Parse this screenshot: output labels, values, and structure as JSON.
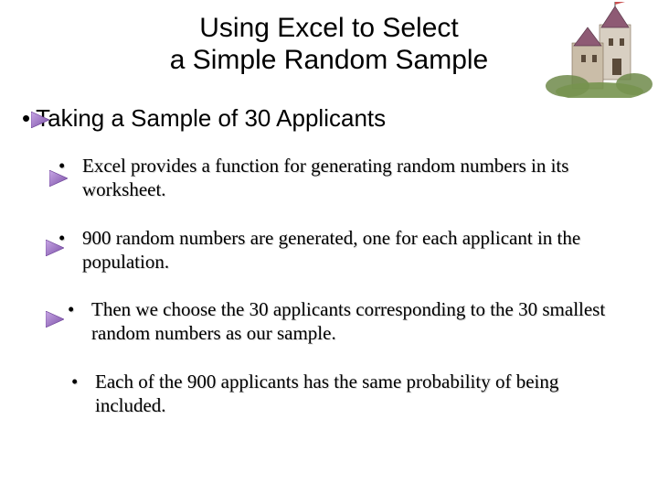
{
  "title_line1": "Using Excel to Select",
  "title_line2": "a Simple Random Sample",
  "subhead": "Taking a Sample of 30 Applicants",
  "bullets": [
    "Excel provides a function for generating random numbers in its worksheet.",
    "900 random numbers are generated, one for each applicant in the population.",
    "Then we choose the 30 applicants corresponding to the 30 smallest random numbers as our sample.",
    "Each of the 900 applicants has the same probability of being included."
  ]
}
